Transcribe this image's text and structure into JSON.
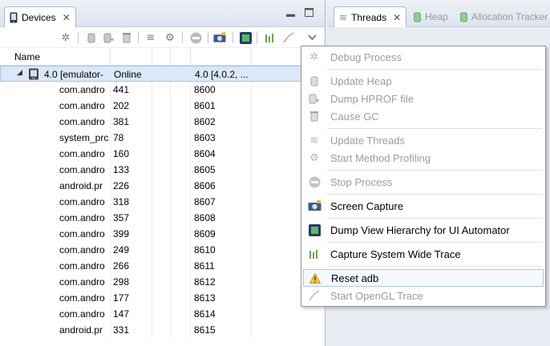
{
  "devices_view": {
    "tab_label": "Devices",
    "column_header": "Name",
    "device_row": {
      "name": "4.0 [emulator-",
      "status": "Online",
      "version": "4.0 [4.0.2, ..."
    },
    "processes": [
      {
        "name": "com.andro",
        "pid": "441",
        "port": "8600"
      },
      {
        "name": "com.andro",
        "pid": "202",
        "port": "8601"
      },
      {
        "name": "com.andro",
        "pid": "381",
        "port": "8602"
      },
      {
        "name": "system_prc",
        "pid": "78",
        "port": "8603"
      },
      {
        "name": "com.andro",
        "pid": "160",
        "port": "8604"
      },
      {
        "name": "com.andro",
        "pid": "133",
        "port": "8605"
      },
      {
        "name": "android.pr",
        "pid": "226",
        "port": "8606"
      },
      {
        "name": "com.andro",
        "pid": "318",
        "port": "8607"
      },
      {
        "name": "com.andro",
        "pid": "357",
        "port": "8608"
      },
      {
        "name": "com.andro",
        "pid": "399",
        "port": "8609"
      },
      {
        "name": "com.andro",
        "pid": "249",
        "port": "8610"
      },
      {
        "name": "com.andro",
        "pid": "266",
        "port": "8611"
      },
      {
        "name": "com.andro",
        "pid": "298",
        "port": "8612"
      },
      {
        "name": "com.andro",
        "pid": "177",
        "port": "8613"
      },
      {
        "name": "com.andro",
        "pid": "147",
        "port": "8614"
      },
      {
        "name": "android.pr",
        "pid": "331",
        "port": "8615"
      }
    ]
  },
  "right_view": {
    "tabs": [
      {
        "label": "Threads",
        "active": true
      },
      {
        "label": "Heap",
        "active": false
      },
      {
        "label": "Allocation Tracker",
        "active": false
      }
    ]
  },
  "menu": {
    "debug_process": "Debug Process",
    "update_heap": "Update Heap",
    "dump_hprof": "Dump HPROF file",
    "cause_gc": "Cause GC",
    "update_threads": "Update Threads",
    "start_method_profiling": "Start Method Profiling",
    "stop_process": "Stop Process",
    "screen_capture": "Screen Capture",
    "dump_view_hierarchy": "Dump View Hierarchy for UI Automator",
    "capture_system_trace": "Capture System Wide Trace",
    "reset_adb": "Reset adb",
    "start_opengl_trace": "Start OpenGL Trace"
  },
  "colors": {
    "selection": "#dbe8fa",
    "menu_hover": "#f5f9ff",
    "disabled_text": "#9c9c9c"
  }
}
